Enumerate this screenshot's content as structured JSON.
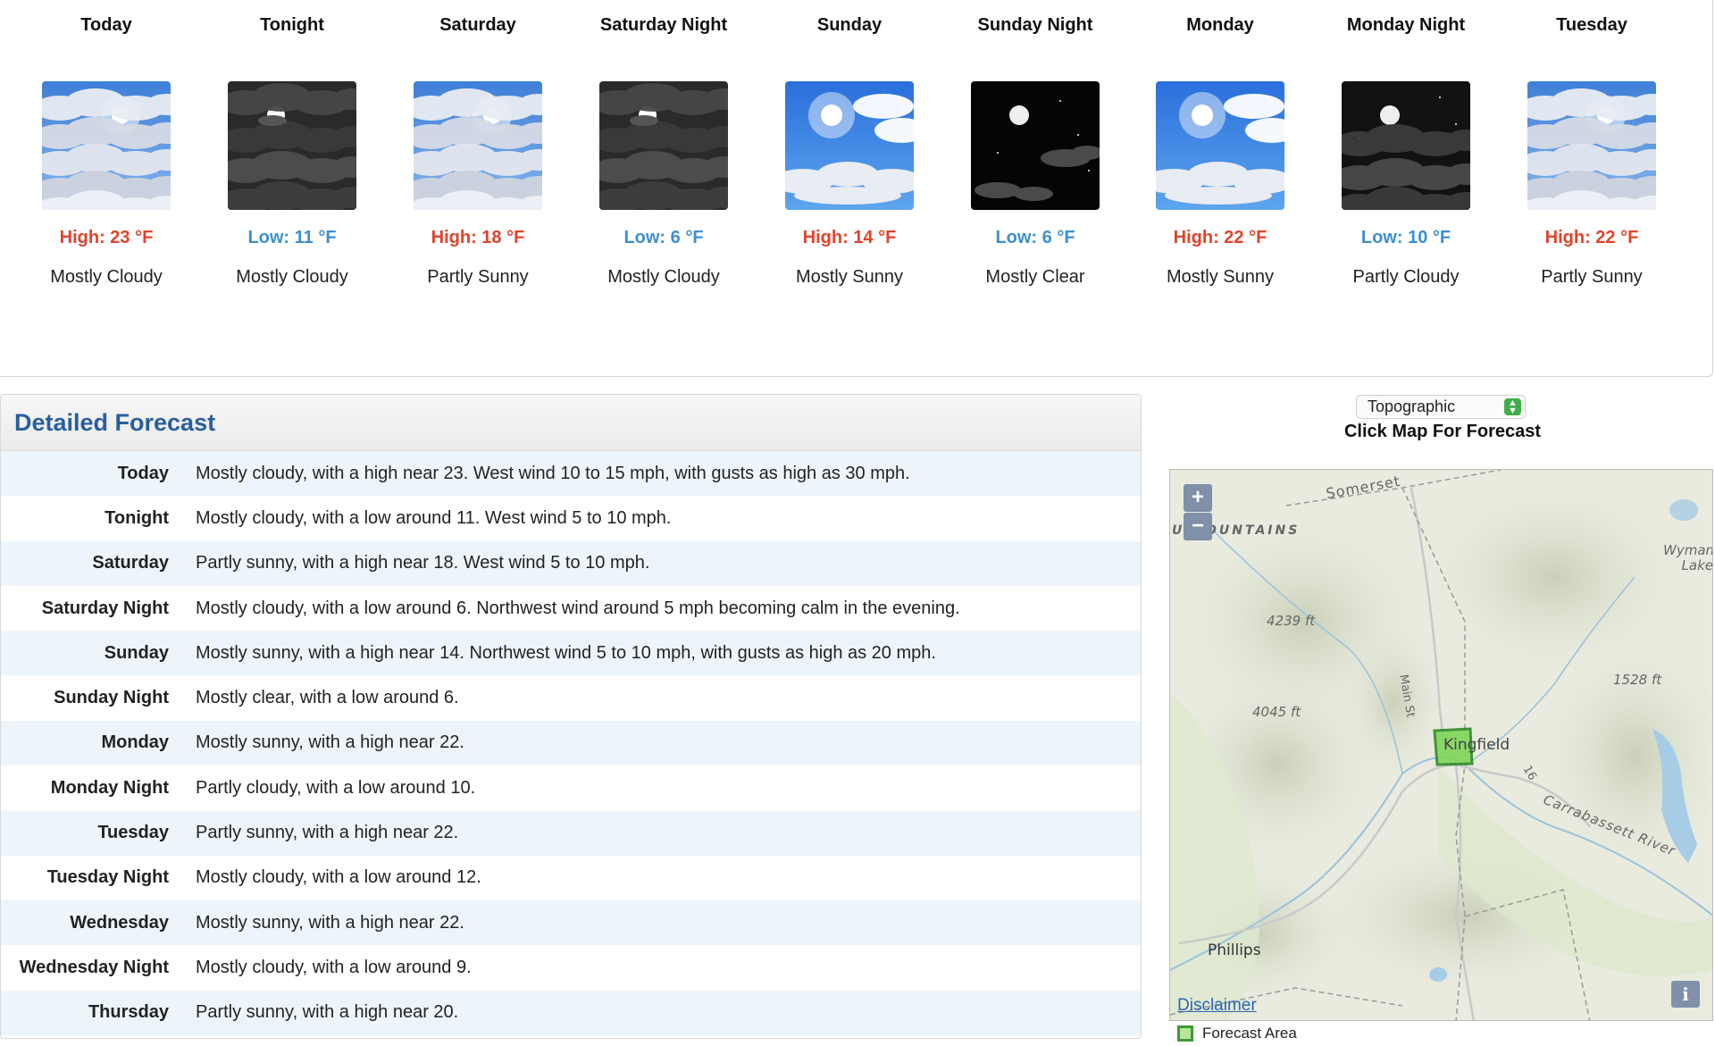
{
  "forecast_strip": [
    {
      "name": "Today",
      "temp": "High: 23 °F",
      "temp_kind": "high",
      "desc": "Mostly Cloudy",
      "icon": "partly-cloudy-day-icon"
    },
    {
      "name": "Tonight",
      "temp": "Low: 11 °F",
      "temp_kind": "low",
      "desc": "Mostly Cloudy",
      "icon": "cloudy-night-icon"
    },
    {
      "name": "Saturday",
      "temp": "High: 18 °F",
      "temp_kind": "high",
      "desc": "Partly Sunny",
      "icon": "partly-cloudy-day-icon"
    },
    {
      "name": "Saturday Night",
      "temp": "Low: 6 °F",
      "temp_kind": "low",
      "desc": "Mostly Cloudy",
      "icon": "cloudy-night-icon"
    },
    {
      "name": "Sunday",
      "temp": "High: 14 °F",
      "temp_kind": "high",
      "desc": "Mostly Sunny",
      "icon": "sunny-day-icon"
    },
    {
      "name": "Sunday Night",
      "temp": "Low: 6 °F",
      "temp_kind": "low",
      "desc": "Mostly Clear",
      "icon": "clear-night-icon"
    },
    {
      "name": "Monday",
      "temp": "High: 22 °F",
      "temp_kind": "high",
      "desc": "Mostly Sunny",
      "icon": "sunny-day-icon"
    },
    {
      "name": "Monday Night",
      "temp": "Low: 10 °F",
      "temp_kind": "low",
      "desc": "Partly Cloudy",
      "icon": "partly-cloudy-night-icon"
    },
    {
      "name": "Tuesday",
      "temp": "High: 22 °F",
      "temp_kind": "high",
      "desc": "Partly Sunny",
      "icon": "partly-cloudy-day-icon"
    }
  ],
  "detailed": {
    "title": "Detailed Forecast",
    "rows": [
      {
        "label": "Today",
        "text": "Mostly cloudy, with a high near 23. West wind 10 to 15 mph, with gusts as high as 30 mph."
      },
      {
        "label": "Tonight",
        "text": "Mostly cloudy, with a low around 11. West wind 5 to 10 mph."
      },
      {
        "label": "Saturday",
        "text": "Partly sunny, with a high near 18. West wind 5 to 10 mph."
      },
      {
        "label": "Saturday Night",
        "text": "Mostly cloudy, with a low around 6. Northwest wind around 5 mph becoming calm in the evening."
      },
      {
        "label": "Sunday",
        "text": "Mostly sunny, with a high near 14. Northwest wind 5 to 10 mph, with gusts as high as 20 mph."
      },
      {
        "label": "Sunday Night",
        "text": "Mostly clear, with a low around 6."
      },
      {
        "label": "Monday",
        "text": "Mostly sunny, with a high near 22."
      },
      {
        "label": "Monday Night",
        "text": "Partly cloudy, with a low around 10."
      },
      {
        "label": "Tuesday",
        "text": "Partly sunny, with a high near 22."
      },
      {
        "label": "Tuesday Night",
        "text": "Mostly cloudy, with a low around 12."
      },
      {
        "label": "Wednesday",
        "text": "Mostly sunny, with a high near 22."
      },
      {
        "label": "Wednesday Night",
        "text": "Mostly cloudy, with a low around 9."
      },
      {
        "label": "Thursday",
        "text": "Partly sunny, with a high near 20."
      }
    ]
  },
  "map": {
    "layer_select": "Topographic",
    "caption": "Click Map For Forecast",
    "zoom_in": "+",
    "zoom_out": "−",
    "labels": {
      "somerset": "Somerset",
      "mountains": "U   OUNTAINS",
      "wyman_lake": "Wyman Lake",
      "elev_4239": "4239 ft",
      "elev_4045": "4045 ft",
      "elev_1528": "1528 ft",
      "main_st": "Main St",
      "kingfield": "Kingfield",
      "route_16": "16",
      "carrabassett": "Carrabassett River",
      "phillips": "Phillips"
    },
    "disclaimer": "Disclaimer",
    "info": "i",
    "legend": "Forecast Area"
  },
  "colors": {
    "high_temp": "#e0432b",
    "low_temp": "#3d8fd1",
    "header_text": "#2a5f9e",
    "forecast_area": "#7fd65a"
  }
}
